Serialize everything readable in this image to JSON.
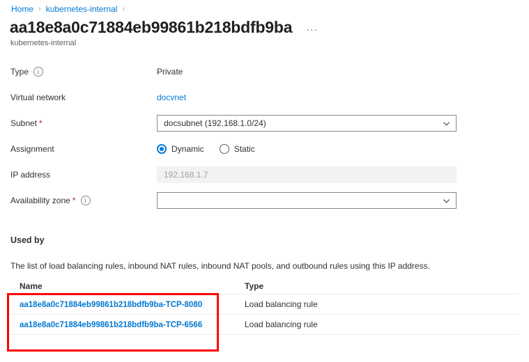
{
  "breadcrumb": {
    "items": [
      {
        "label": "Home"
      },
      {
        "label": "kubernetes-internal"
      }
    ],
    "separator": "›"
  },
  "header": {
    "title": "aa18e8a0c71884eb99861b218bdfb9ba",
    "subtitle": "kubernetes-internal",
    "more_label": "···"
  },
  "form": {
    "type": {
      "label": "Type",
      "info": "i",
      "value": "Private"
    },
    "virtual_network": {
      "label": "Virtual network",
      "value": "docvnet"
    },
    "subnet": {
      "label": "Subnet",
      "required": "*",
      "value": "docsubnet (192.168.1.0/24)"
    },
    "assignment": {
      "label": "Assignment",
      "options": [
        {
          "label": "Dynamic",
          "selected": true
        },
        {
          "label": "Static",
          "selected": false
        }
      ]
    },
    "ip_address": {
      "label": "IP address",
      "value": "192.168.1.7"
    },
    "availability_zone": {
      "label": "Availability zone",
      "required": "*",
      "info": "i",
      "value": ""
    }
  },
  "used_by": {
    "heading": "Used by",
    "description": "The list of load balancing rules, inbound NAT rules, inbound NAT pools, and outbound rules using this IP address.",
    "columns": {
      "name": "Name",
      "type": "Type"
    },
    "rows": [
      {
        "name": "aa18e8a0c71884eb99861b218bdfb9ba-TCP-8080",
        "type": "Load balancing rule"
      },
      {
        "name": "aa18e8a0c71884eb99861b218bdfb9ba-TCP-6566",
        "type": "Load balancing rule"
      }
    ]
  },
  "colors": {
    "link": "#0078d4",
    "accent": "#0078d4",
    "required": "#a4262c",
    "annotation": "#ff0000",
    "readonly_bg": "#f3f2f1"
  }
}
